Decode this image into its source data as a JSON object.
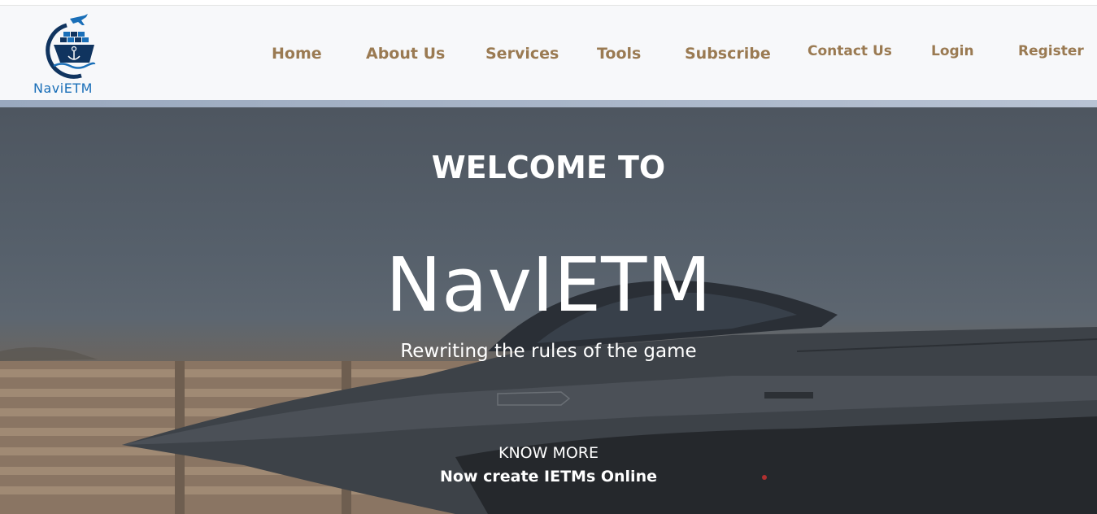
{
  "brand": {
    "logo_text": "NaviETM",
    "logo_colors": {
      "primary": "#1a6fb8",
      "dark": "#10345f"
    }
  },
  "nav": {
    "items": [
      {
        "label": "Home"
      },
      {
        "label": "About Us"
      },
      {
        "label": "Services"
      },
      {
        "label": "Tools"
      },
      {
        "label": "Subscribe"
      },
      {
        "label": "Contact Us"
      },
      {
        "label": "Login"
      },
      {
        "label": "Register"
      }
    ],
    "color": "#9a7a52"
  },
  "hero": {
    "welcome": "WELCOME TO",
    "title": "NavIETM",
    "tagline": "Rewriting the rules of the game",
    "cta": "KNOW MORE",
    "sub_cta": "Now create IETMs Online",
    "background": "fighter-jet-photo"
  }
}
